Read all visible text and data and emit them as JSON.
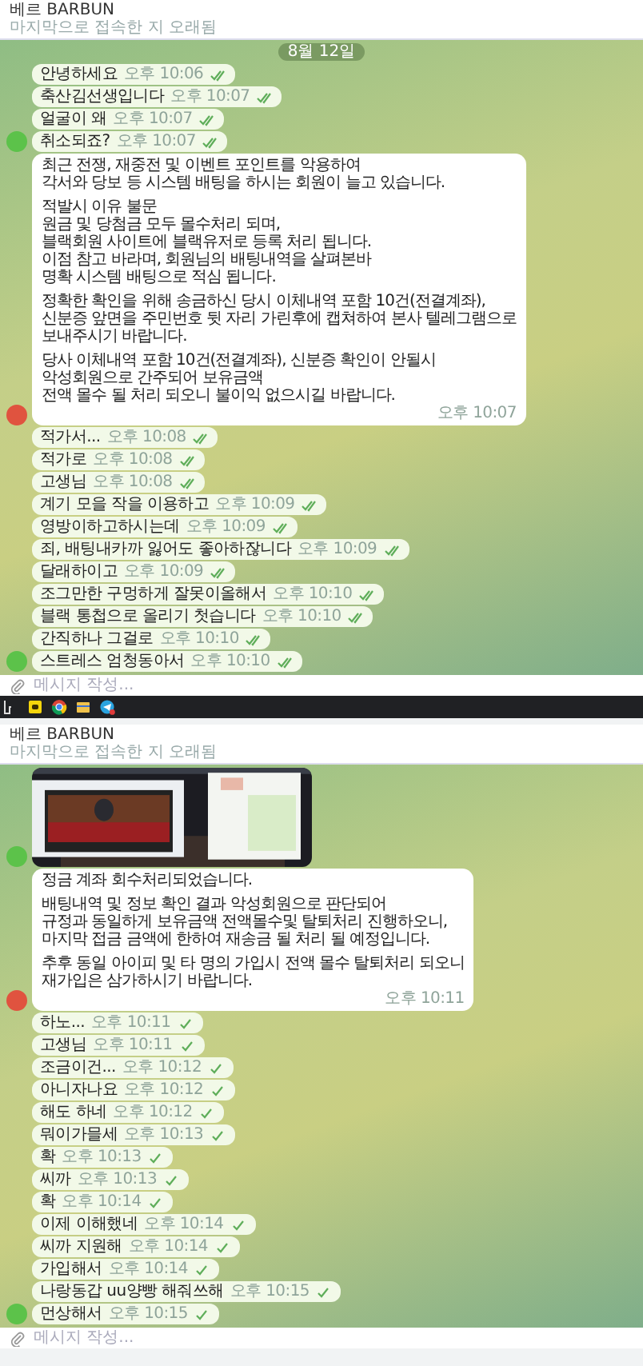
{
  "panels": [
    {
      "header": {
        "title": "베르 BARBUN",
        "subtitle": "마지막으로 접속한 지 오래됨"
      },
      "date_chip": "8월 12일",
      "input": {
        "placeholder": "메시지 작성..."
      },
      "has_taskbar": true,
      "messages": [
        {
          "kind": "text",
          "text": "안녕하세요",
          "time": "오후 10:06",
          "read": true
        },
        {
          "kind": "text",
          "text": "축산김선생입니다",
          "time": "오후 10:07",
          "read": true
        },
        {
          "kind": "text",
          "text": "얼굴이 왜",
          "time": "오후 10:07",
          "read": true
        },
        {
          "kind": "text",
          "text": "취소되죠?",
          "time": "오후 10:07",
          "read": true,
          "avatar": {
            "color": "#5cc24a"
          }
        },
        {
          "kind": "long",
          "text": "최근 전쟁, 재중전 및 이벤트 포인트를 악용하여\n각서와 당보 등 시스템 배팅을 하시는 회원이 늘고 있습니다.\n\n적발시 이유 불문\n원금 및 당첨금 모두 몰수처리 되며,\n블랙회원 사이트에 블랙유저로 등록 처리 됩니다.\n이점 참고 바라며, 회원님의 배팅내역을 살펴본바\n명확 시스템 배팅으로 적심 됩니다.\n\n정확한 확인을 위해 송금하신 당시 이체내역 포함 10건(전결계좌),\n신분증 앞면을 주민번호 뒷 자리 가린후에 캡쳐하여 본사 텔레그램으로\n보내주시기 바랍니다.\n\n당사 이체내역 포함 10건(전결계좌), 신분증 확인이 안될시\n악성회원으로 간주되어 보유금액\n전액 몰수 될 처리 되오니 불이익 없으시길 바랍니다.",
          "time": "오후 10:07",
          "avatar": {
            "color": "#e0533f"
          }
        },
        {
          "kind": "text",
          "text": "적가서...",
          "time": "오후 10:08",
          "read": true
        },
        {
          "kind": "text",
          "text": "적가로",
          "time": "오후 10:08",
          "read": true
        },
        {
          "kind": "text",
          "text": "고생님",
          "time": "오후 10:08",
          "read": true
        },
        {
          "kind": "text",
          "text": "계기 모을 작을 이용하고",
          "time": "오후 10:09",
          "read": true
        },
        {
          "kind": "text",
          "text": "영방이하고하시는데",
          "time": "오후 10:09",
          "read": true
        },
        {
          "kind": "text",
          "text": "죄, 배팅내카까 잃어도 좋아하잖니다",
          "time": "오후 10:09",
          "read": true
        },
        {
          "kind": "text",
          "text": "달래하이고",
          "time": "오후 10:09",
          "read": true
        },
        {
          "kind": "text",
          "text": "조그만한 구멍하게 잘못이올해서",
          "time": "오후 10:10",
          "read": true
        },
        {
          "kind": "text",
          "text": "블랙 통첩으로 올리기 첫습니다",
          "time": "오후 10:10",
          "read": true
        },
        {
          "kind": "text",
          "text": "간직하나 그걸로",
          "time": "오후 10:10",
          "read": true
        },
        {
          "kind": "text",
          "text": "스트레스 엄청동아서",
          "time": "오후 10:10",
          "read": true,
          "avatar": {
            "color": "#5cc24a"
          }
        }
      ]
    },
    {
      "header": {
        "title": "베르 BARBUN",
        "subtitle": "마지막으로 접속한 지 오래됨"
      },
      "input": {
        "placeholder": "메시지 작성..."
      },
      "messages": [
        {
          "kind": "picture",
          "avatar": {
            "color": "#5cc24a"
          }
        },
        {
          "kind": "long",
          "text": "정금 계좌 회수처리되었습니다.\n\n배팅내역 및 정보 확인 결과 악성회원으로 판단되어\n규정과 동일하게 보유금액 전액몰수및 탈퇴처리 진행하오니,\n마지막 접금 금액에 한하여 재송금 될 처리 될 예정입니다.\n\n추후 동일 아이피 및 타 명의 가입시 전액 몰수 탈퇴처리 되오니\n재가입은 삼가하시기 바랍니다.",
          "time": "오후 10:11",
          "avatar": {
            "color": "#e0533f"
          }
        },
        {
          "kind": "text",
          "text": "하노...",
          "time": "오후 10:11",
          "read": false
        },
        {
          "kind": "text",
          "text": "고생님",
          "time": "오후 10:11",
          "read": false
        },
        {
          "kind": "text",
          "text": "조금이건...",
          "time": "오후 10:12",
          "read": false
        },
        {
          "kind": "text",
          "text": "아니자나요",
          "time": "오후 10:12",
          "read": false
        },
        {
          "kind": "text",
          "text": "해도 하네",
          "time": "오후 10:12",
          "read": false
        },
        {
          "kind": "text",
          "text": "뭐이가믈세",
          "time": "오후 10:13",
          "read": false
        },
        {
          "kind": "text",
          "text": "확",
          "time": "오후 10:13",
          "read": false
        },
        {
          "kind": "text",
          "text": "씨까",
          "time": "오후 10:13",
          "read": false
        },
        {
          "kind": "text",
          "text": "확",
          "time": "오후 10:14",
          "read": false
        },
        {
          "kind": "text",
          "text": "이제 이해했네",
          "time": "오후 10:14",
          "read": false
        },
        {
          "kind": "text",
          "text": "씨까 지원해",
          "time": "오후 10:14",
          "read": false
        },
        {
          "kind": "text",
          "text": "가입해서",
          "time": "오후 10:14",
          "read": false
        },
        {
          "kind": "text",
          "text": "나랑동갑 uu양빵 해줘쓰해",
          "time": "오후 10:15",
          "read": false
        },
        {
          "kind": "text",
          "text": "먼상해서",
          "time": "오후 10:15",
          "read": false,
          "avatar": {
            "color": "#5cc24a"
          }
        }
      ]
    }
  ]
}
